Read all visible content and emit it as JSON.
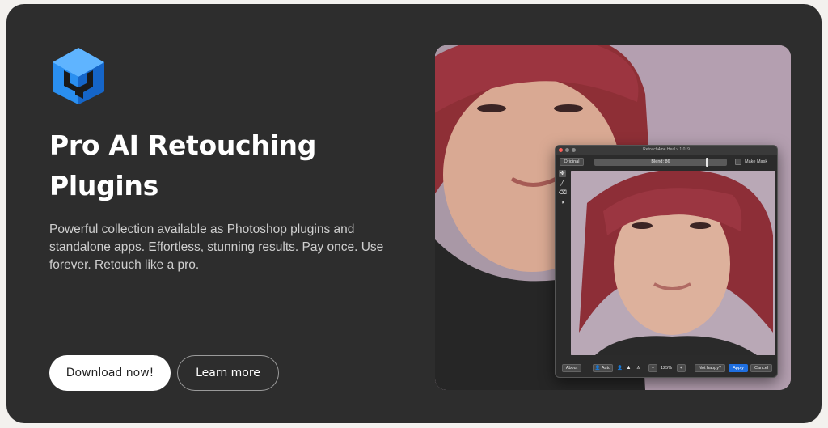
{
  "hero": {
    "headline": "Pro AI Retouching Plugins",
    "description": "Powerful collection available as Photoshop plugins and standalone apps. Effortless, stunning results. Pay once. Use forever. Retouch like a pro.",
    "primary_button": "Download now!",
    "secondary_button": "Learn more"
  },
  "app": {
    "title": "Retouch4me Heal v 1.019",
    "original_label": "Original",
    "blend_label": "Blend: 86",
    "blend_value": 0.86,
    "make_mask_label": "Make Mask",
    "about_label": "About",
    "auto_label": "Auto",
    "zoom_minus": "−",
    "zoom_level": "125%",
    "zoom_plus": "+",
    "not_happy_label": "Not happy?",
    "apply_label": "Apply",
    "cancel_label": "Cancel"
  },
  "colors": {
    "card_bg": "#2d2d2d",
    "page_bg": "#f3f1ee",
    "accent_blue": "#1f6fe0",
    "logo_blue": "#2a8ff0"
  },
  "icons": [
    "logo-cube-icon",
    "move-tool-icon",
    "brush-tool-icon",
    "eraser-tool-icon",
    "contrast-tool-icon",
    "person-icon"
  ]
}
